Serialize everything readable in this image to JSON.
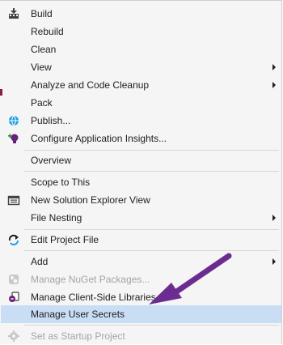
{
  "menu": {
    "items": [
      {
        "label": "Build",
        "icon": "build-icon"
      },
      {
        "label": "Rebuild"
      },
      {
        "label": "Clean"
      },
      {
        "label": "View",
        "submenu": true
      },
      {
        "label": "Analyze and Code Cleanup",
        "submenu": true
      },
      {
        "label": "Pack"
      },
      {
        "label": "Publish...",
        "icon": "globe-publish-icon"
      },
      {
        "label": "Configure Application Insights...",
        "icon": "lightbulb-icon"
      },
      {
        "label": "Overview"
      },
      {
        "label": "Scope to This"
      },
      {
        "label": "New Solution Explorer View",
        "icon": "solution-explorer-icon"
      },
      {
        "label": "File Nesting",
        "submenu": true
      },
      {
        "label": "Edit Project File",
        "icon": "edit-project-icon"
      },
      {
        "label": "Add",
        "submenu": true
      },
      {
        "label": "Manage NuGet Packages...",
        "disabled": true,
        "icon": "nuget-icon"
      },
      {
        "label": "Manage Client-Side Libraries...",
        "icon": "client-libraries-icon"
      },
      {
        "label": "Manage User Secrets",
        "highlighted": true
      },
      {
        "label": "Set as Startup Project",
        "disabled": true,
        "icon": "gear-icon"
      }
    ]
  },
  "colors": {
    "highlight": "#c9def5",
    "annotation_arrow": "#6a2c91"
  }
}
